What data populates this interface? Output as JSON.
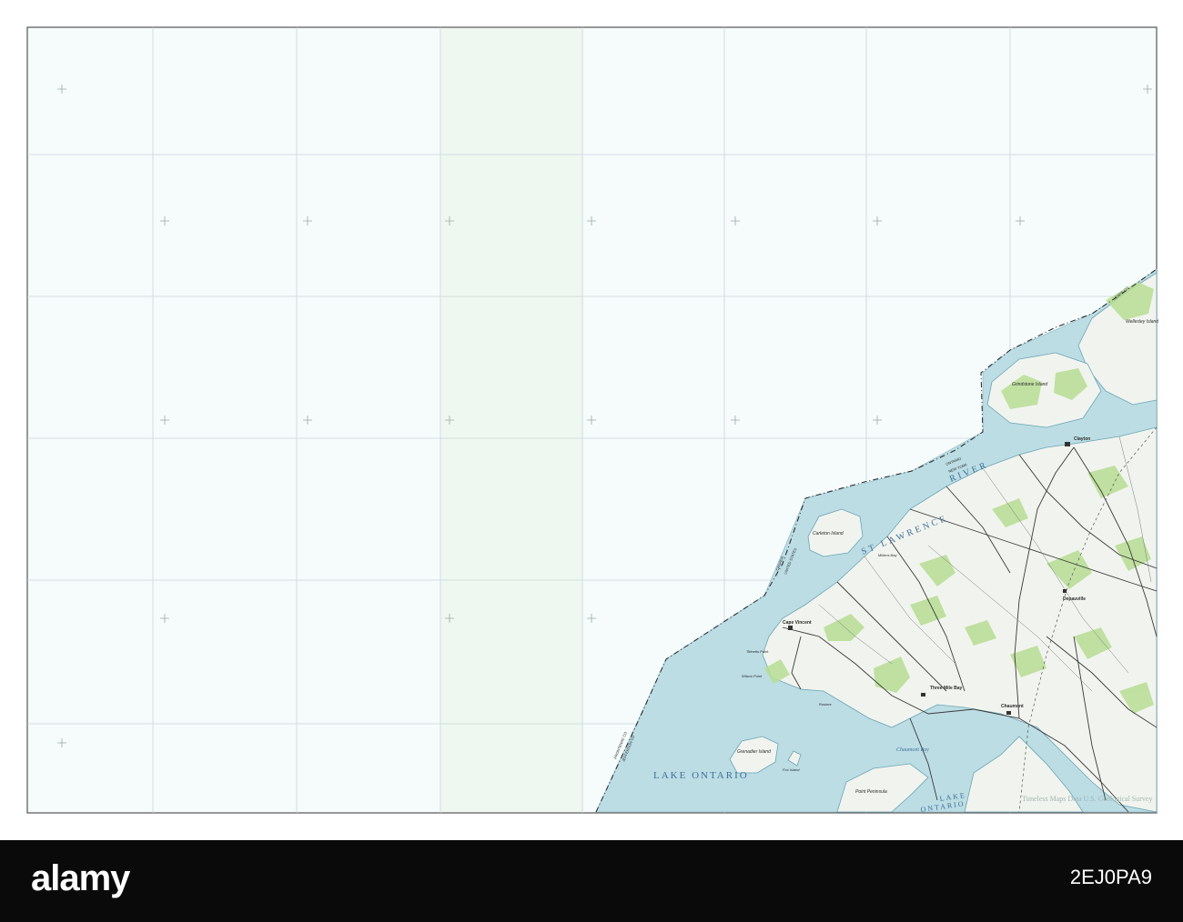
{
  "water_labels": {
    "lake_ontario_main": "LAKE ONTARIO",
    "lake_ontario_sub": "LAKE",
    "lake_ontario_sub2": "ONTARIO",
    "st_lawrence": "ST LAWRENCE",
    "river": "RIVER",
    "chaumont_bay": "Chaumont Bay"
  },
  "place_labels": {
    "carleton_island": "Carleton Island",
    "grindstone_island": "Grindstone Island",
    "wellesley_island": "Wellesley Island",
    "clayton": "Clayton",
    "cape_vincent": "Cape Vincent",
    "three_mile_bay": "Three Mile Bay",
    "point_peninsula": "Point Peninsula",
    "grenadier_island": "Grenadier Island",
    "depauville": "Depauville",
    "chaumont": "Chaumont",
    "fox_island": "Fox Island",
    "rosiere": "Rosiere",
    "millens_bay": "Millens Bay",
    "wilson_point": "Wilson Point",
    "tibbetts_point": "Tibbetts Point"
  },
  "boundary_labels": {
    "canada": "CANADA",
    "united_states": "UNITED STATES",
    "ontario": "ONTARIO",
    "new_york": "NEW YORK",
    "frontenac_co": "FRONTENAC CO",
    "jefferson_co": "JEFFERSON CO",
    "leeds_co": "LEEDS CO"
  },
  "watermark": "Timeless Maps Data U.S. Geological Survey",
  "stock_bar": {
    "logo": "alamy",
    "image_id": "2EJ0PA9"
  },
  "colors": {
    "paper": "#f6fbfb",
    "water": "#bcdde4",
    "land": "#f1f4ee",
    "vegetation": "#b7dd93",
    "grid": "#c8d6dc",
    "roads": "#3a3a3a",
    "border": "#6a6a6a"
  }
}
